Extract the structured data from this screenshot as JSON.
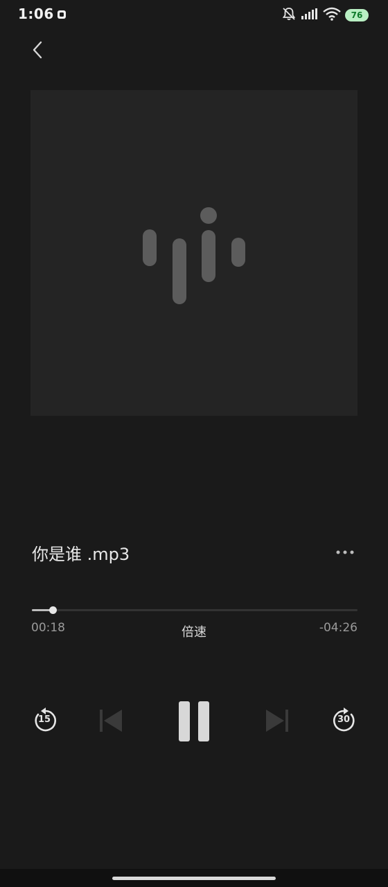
{
  "status_bar": {
    "time": "1:06",
    "battery_level": "76",
    "icons": [
      "app-notification-icon",
      "bell-muted-icon",
      "signal-icon",
      "wifi-icon",
      "battery-icon"
    ]
  },
  "nav": {
    "back_icon": "chevron-left-icon"
  },
  "artwork": {
    "icon": "audio-waveform-logo"
  },
  "track": {
    "title": "你是谁 .mp3",
    "more_icon": "more-horizontal-icon"
  },
  "progress": {
    "elapsed": "00:18",
    "remaining": "-04:26",
    "fraction": 0.063
  },
  "speed": {
    "label": "倍速"
  },
  "controls": {
    "rewind_seconds": "15",
    "forward_seconds": "30",
    "prev_icon": "skip-previous-icon",
    "pause_icon": "pause-icon",
    "next_icon": "skip-next-icon"
  },
  "colors": {
    "background": "#1a1a1a",
    "artwork_bg": "#242424",
    "waveform": "#5c5c5c",
    "text_primary": "#e8e8e8",
    "text_secondary": "#9a9a9a",
    "disabled_control": "#3a3a3a",
    "battery_fill": "#b9efc3"
  }
}
